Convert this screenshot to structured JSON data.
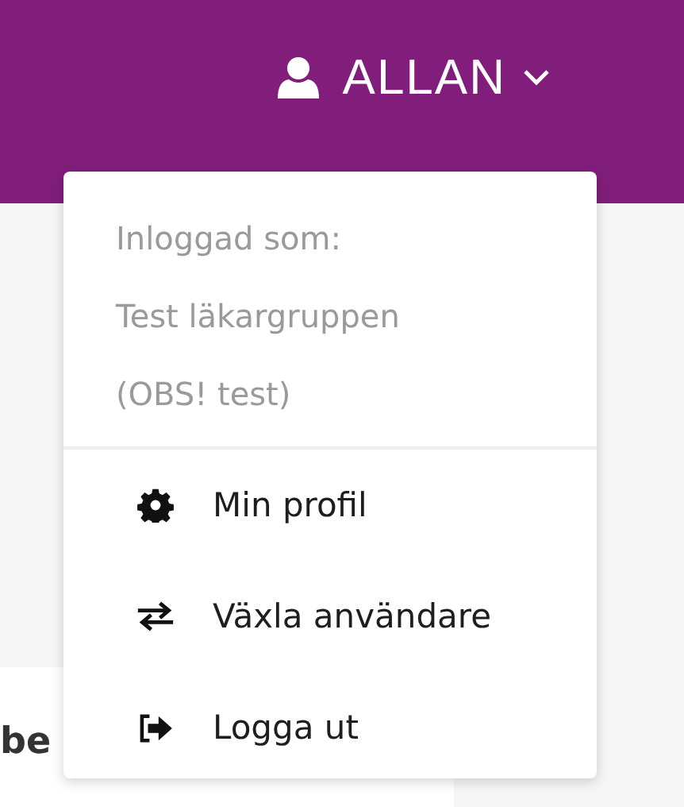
{
  "header": {
    "user_name": "ALLAN"
  },
  "content": {
    "heading_fragment": "be"
  },
  "user_menu": {
    "info_lines": [
      "Inloggad som:",
      "Test läkargruppen",
      "(OBS! test)"
    ],
    "items": [
      {
        "kind": "settings",
        "label": "Min profil"
      },
      {
        "kind": "switch",
        "label": "Växla användare"
      },
      {
        "kind": "logout",
        "label": "Logga ut"
      }
    ]
  }
}
